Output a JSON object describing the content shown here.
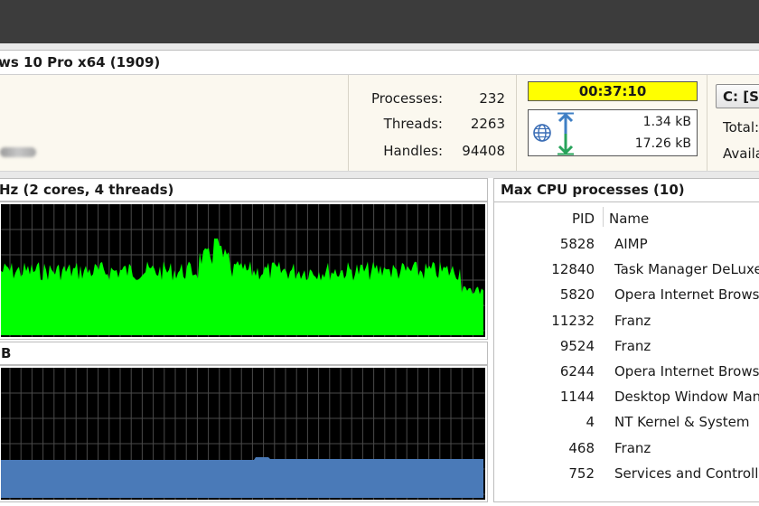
{
  "header": {
    "os_title": "ws 10 Pro x64 (1909)"
  },
  "stats": {
    "processes_label": "Processes:",
    "processes_value": "232",
    "threads_label": "Threads:",
    "threads_value": "2263",
    "handles_label": "Handles:",
    "handles_value": "94408"
  },
  "uptime": "00:37:10",
  "network": {
    "icon": "globe-icon",
    "upload": "1.34 kB",
    "download": "17.26 kB"
  },
  "drive": {
    "label": "C: [S",
    "total_label": "Total:",
    "available_label": "Availa"
  },
  "cpu_panel": {
    "title": "Hz (2 cores, 4 threads)"
  },
  "memory_panel": {
    "title": "B"
  },
  "processes_panel": {
    "title": "Max CPU processes (10)",
    "columns": [
      "PID",
      "Name"
    ],
    "rows": [
      {
        "pid": "5828",
        "name": "AIMP"
      },
      {
        "pid": "12840",
        "name": "Task Manager DeLuxe"
      },
      {
        "pid": "5820",
        "name": "Opera Internet Brows"
      },
      {
        "pid": "11232",
        "name": "Franz"
      },
      {
        "pid": "9524",
        "name": "Franz"
      },
      {
        "pid": "6244",
        "name": "Opera Internet Brows"
      },
      {
        "pid": "1144",
        "name": "Desktop Window Man"
      },
      {
        "pid": "4",
        "name": "NT Kernel & System"
      },
      {
        "pid": "468",
        "name": "Franz"
      },
      {
        "pid": "752",
        "name": "Services and Controlle"
      }
    ]
  },
  "colors": {
    "cpu_fill": "#00ff00",
    "memory_fill": "#4a7ab8",
    "chart_bg": "#000000",
    "grid": "#4a4a4a",
    "uptime_bg": "#ffff00",
    "upload_arrow": "#3f7fc4",
    "download_arrow": "#27a35a"
  }
}
